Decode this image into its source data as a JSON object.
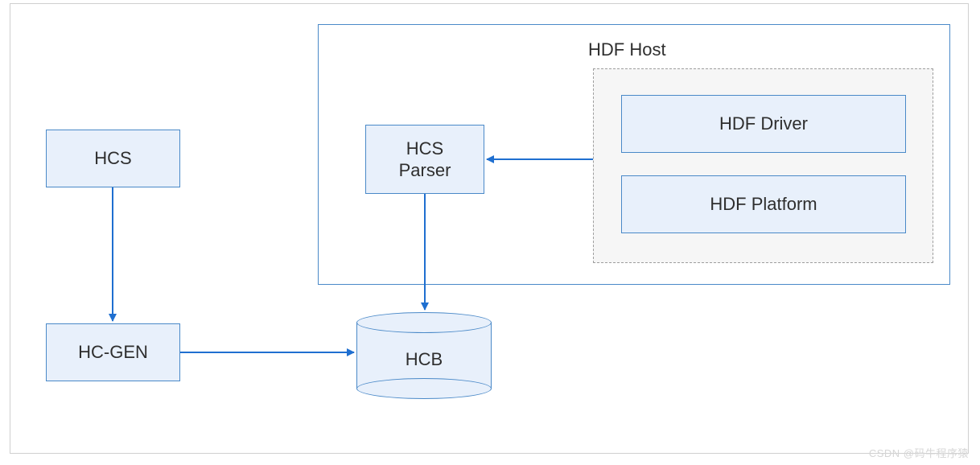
{
  "diagram": {
    "hcs": "HCS",
    "hcgen": "HC-GEN",
    "hcb": "HCB",
    "hcs_parser": "HCS\nParser",
    "hdf_host": "HDF Host",
    "hdf_driver": "HDF Driver",
    "hdf_platform": "HDF Platform"
  },
  "watermark": "CSDN @码牛程序猿",
  "colors": {
    "box_fill": "#e8f0fb",
    "box_border": "#4a89c8",
    "arrow": "#1f6fd0",
    "dashed_border": "#9e9e9e",
    "dashed_fill": "#f6f6f6"
  }
}
